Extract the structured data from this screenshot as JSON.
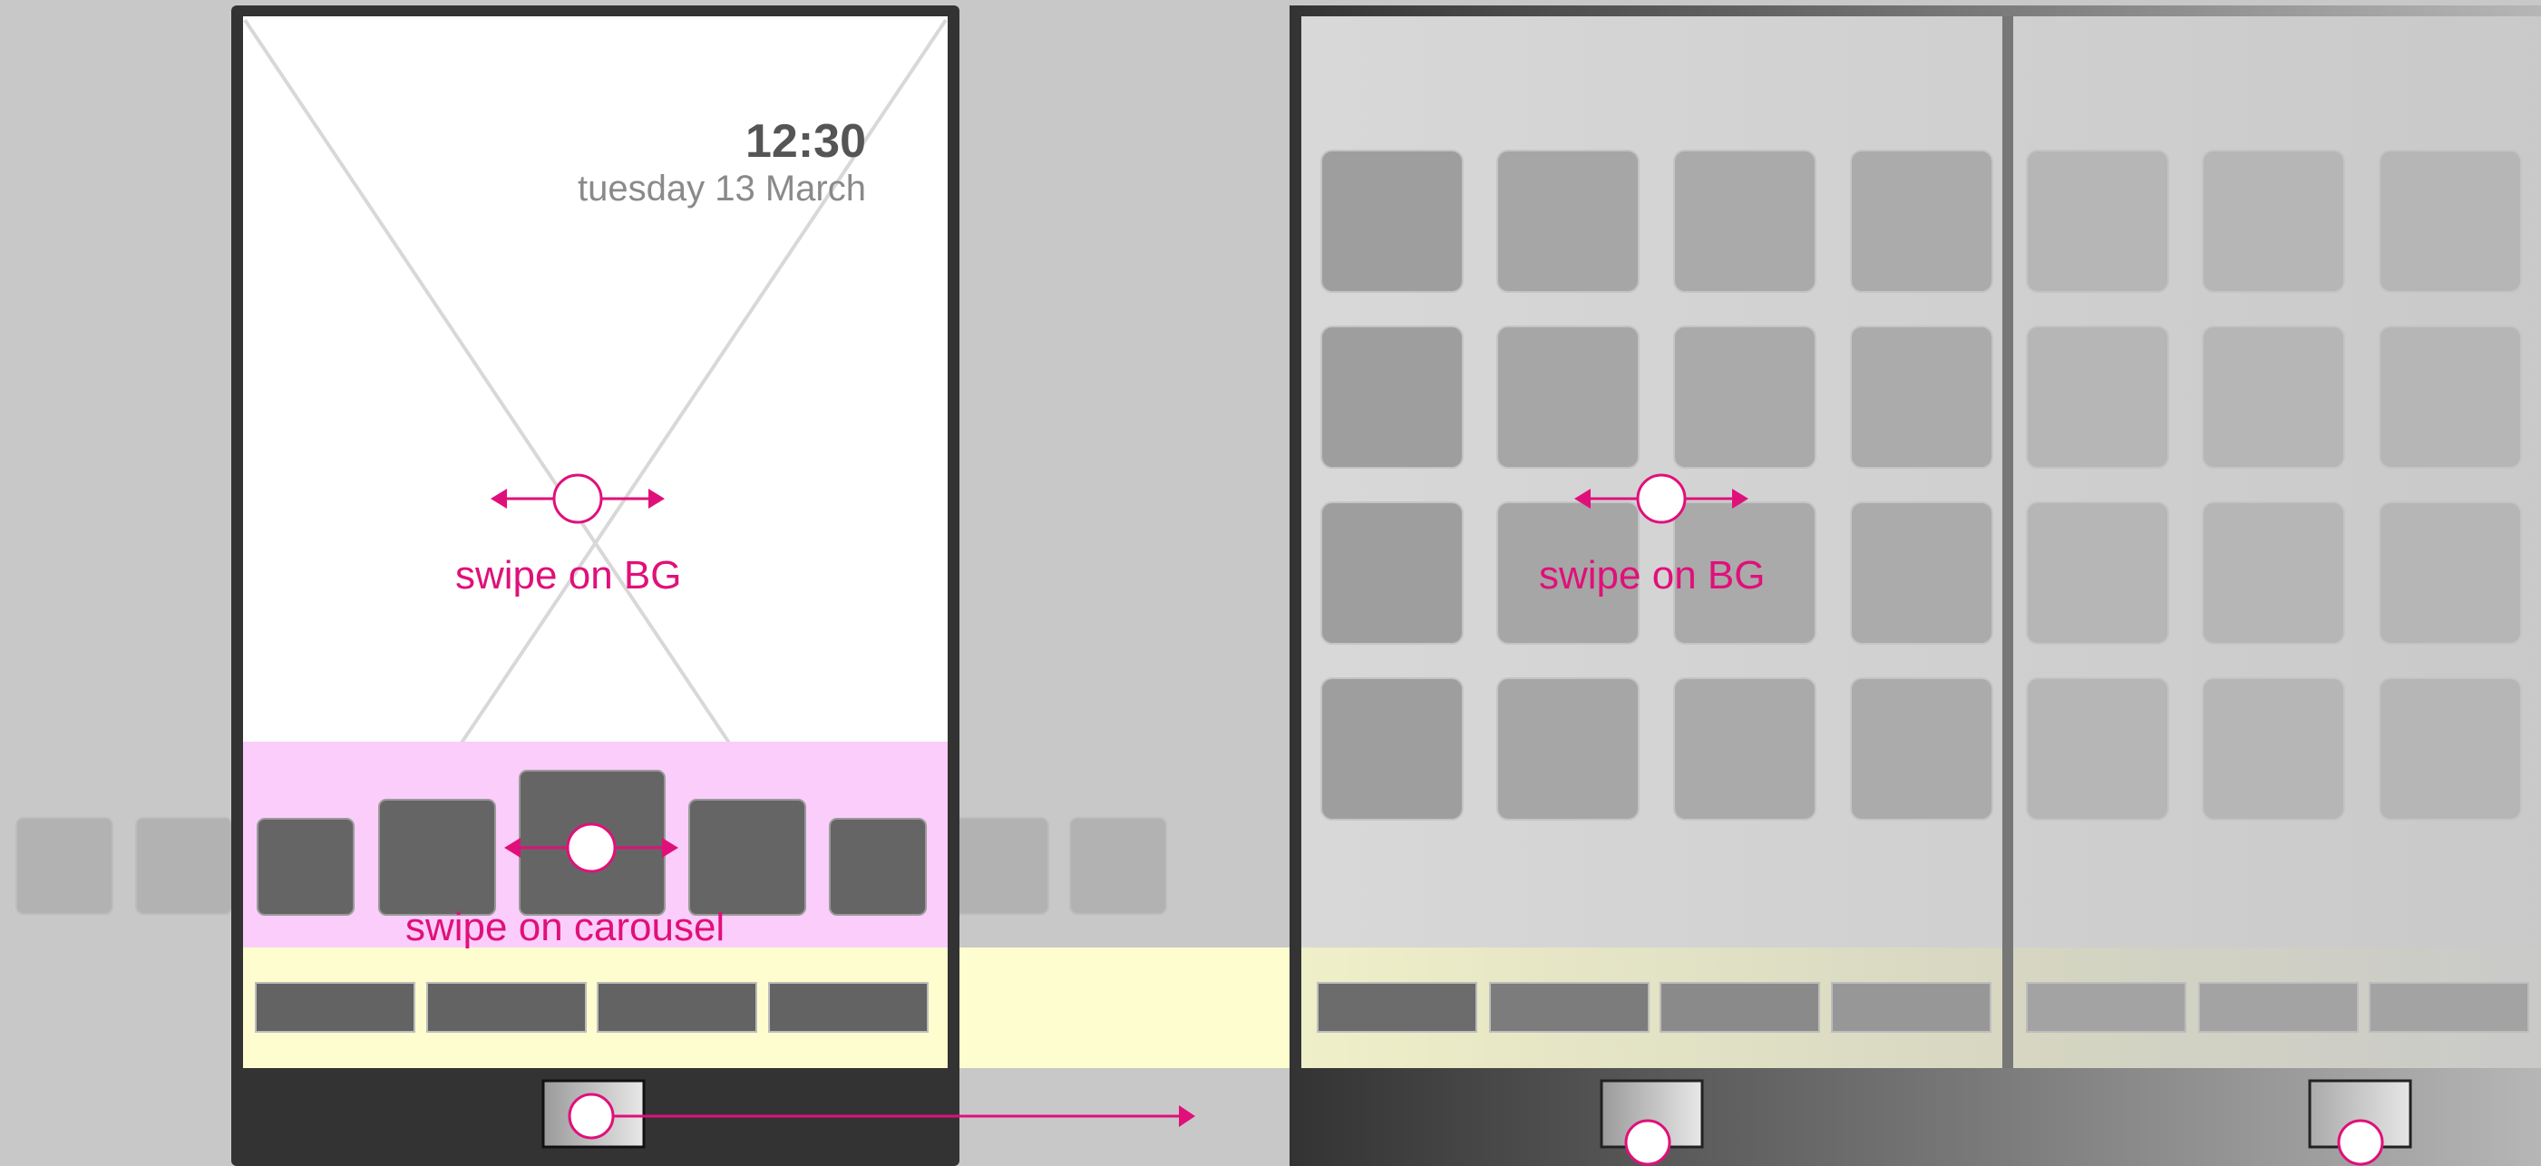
{
  "lock_screen": {
    "time": "12:30",
    "date": "tuesday 13 March"
  },
  "annotations": {
    "swipe_bg": "swipe on BG",
    "swipe_carousel": "swipe on carousel"
  },
  "colors": {
    "page_bg": "#c8c8c8",
    "device_frame": "#333333",
    "annotation": "#e0107a",
    "carousel_band": "#fbcdfb",
    "dock_band": "#fdfdd0",
    "icon_dark": "#656565",
    "icon_light": "#a9a9a9",
    "homescreen_bg": "#d6d6d6"
  }
}
